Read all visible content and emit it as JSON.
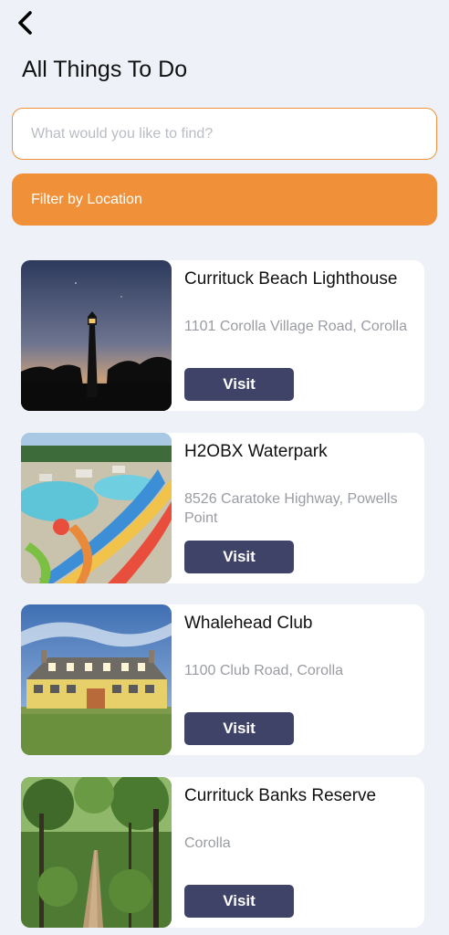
{
  "header": {
    "back_icon": "chevron-left-icon",
    "title": "All Things To Do"
  },
  "search": {
    "placeholder": "What would you like to find?",
    "value": ""
  },
  "filter": {
    "label": "Filter by Location"
  },
  "colors": {
    "accent": "#f0913a",
    "button": "#3f4368",
    "background": "#eef1f8"
  },
  "attractions": [
    {
      "name": "Currituck Beach Lighthouse",
      "address": "1101 Corolla Village Road, Corolla",
      "button": "Visit"
    },
    {
      "name": "H2OBX Waterpark",
      "address": "8526 Caratoke Highway, Powells Point",
      "button": "Visit"
    },
    {
      "name": "Whalehead Club",
      "address": "1100 Club Road, Corolla",
      "button": "Visit"
    },
    {
      "name": "Currituck Banks Reserve",
      "address": "Corolla",
      "button": "Visit"
    }
  ]
}
